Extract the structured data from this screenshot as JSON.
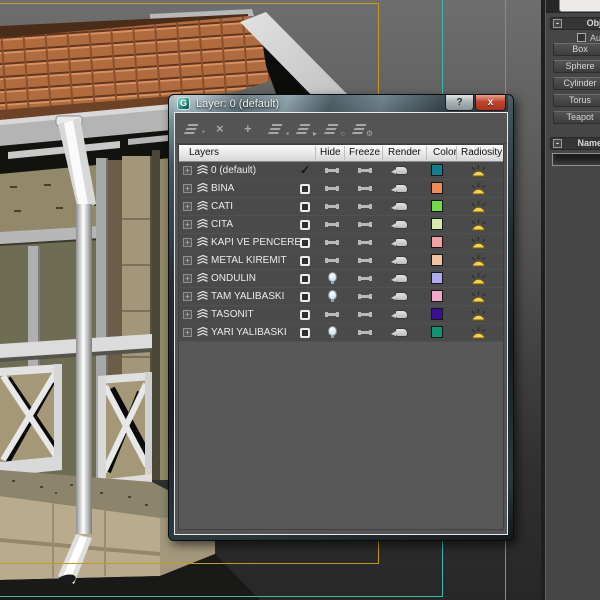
{
  "dialog": {
    "title": "Layer: 0 (default)",
    "help_label": "?",
    "close_label": "x",
    "toolbar": [
      {
        "name": "create-new-layer-icon",
        "style": "layers",
        "mod": "*"
      },
      {
        "name": "delete-layer-icon",
        "style": "solo",
        "mod": "×"
      },
      {
        "name": "add-selection-to-layer-icon",
        "style": "solo",
        "mod": "+"
      },
      {
        "name": "select-objects-in-layer-icon",
        "style": "layers",
        "mod": "▪"
      },
      {
        "name": "set-current-layer-icon",
        "style": "layers",
        "mod": "▸"
      },
      {
        "name": "highlight-layer-icon",
        "style": "layers",
        "mod": "○"
      },
      {
        "name": "layer-properties-icon",
        "style": "layers",
        "mod": "⚙"
      }
    ],
    "columns": [
      "Layers",
      "Hide",
      "Freeze",
      "Render",
      "Color",
      "Radiosity"
    ],
    "rows": [
      {
        "name": "0 (default)",
        "current": true,
        "hidden": false,
        "color": "#0f7f8f"
      },
      {
        "name": "BINA",
        "current": false,
        "hidden": false,
        "color": "#ef8c52"
      },
      {
        "name": "CATI",
        "current": false,
        "hidden": false,
        "color": "#72dd46"
      },
      {
        "name": "CITA",
        "current": false,
        "hidden": false,
        "color": "#d9eaa8"
      },
      {
        "name": "KAPI VE PENCERE",
        "current": false,
        "hidden": false,
        "color": "#f2a2a2"
      },
      {
        "name": "METAL KIREMIT",
        "current": false,
        "hidden": false,
        "color": "#f0c49e"
      },
      {
        "name": "ONDULIN",
        "current": false,
        "hidden": true,
        "color": "#b0aaf2"
      },
      {
        "name": "TAM YALIBASKI",
        "current": false,
        "hidden": true,
        "color": "#f2a8cc"
      },
      {
        "name": "TASONIT",
        "current": false,
        "hidden": false,
        "color": "#3a0e96"
      },
      {
        "name": "YARI YALIBASKI",
        "current": false,
        "hidden": true,
        "color": "#0e9472"
      }
    ]
  },
  "panel": {
    "object_type_rollout": "Object Type",
    "autogrid_label": "AutoGrid",
    "buttons": [
      "Box",
      "Sphere",
      "Cylinder",
      "Torus",
      "Teapot"
    ],
    "name_rollout": "Name and Color",
    "name_field_value": ""
  },
  "viewport": {
    "title_safe_color": "#c49b22",
    "action_safe_color": "#38bdb6",
    "live_area_color": "#9e9520",
    "close_button_color": "#c0452e"
  }
}
